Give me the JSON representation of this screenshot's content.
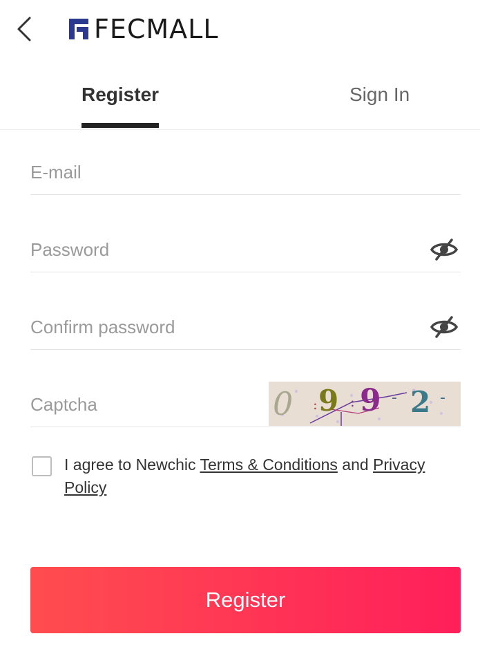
{
  "header": {
    "logo_text": "FECMALL",
    "logo_color": "#2b3a8f"
  },
  "tabs": [
    {
      "label": "Register",
      "active": true
    },
    {
      "label": "Sign In",
      "active": false
    }
  ],
  "form": {
    "email_placeholder": "E-mail",
    "password_placeholder": "Password",
    "confirm_placeholder": "Confirm password",
    "captcha_placeholder": "Captcha",
    "captcha_text": "0:9:9-2-"
  },
  "agreement": {
    "prefix": "I agree to Newchic ",
    "terms_link": "Terms & Conditions",
    "conjunction": " and ",
    "privacy_link": "Privacy Policy",
    "checked": false
  },
  "submit_label": "Register",
  "colors": {
    "accent_start": "#ff4d4f",
    "accent_end": "#ff1f5a"
  }
}
